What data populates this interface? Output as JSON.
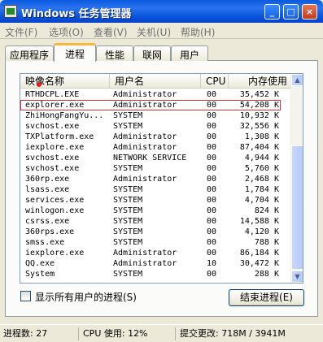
{
  "window": {
    "title": "Windows 任务管理器"
  },
  "titlebar_buttons": {
    "minimize": "_",
    "maximize": "□",
    "close": "×"
  },
  "menu": [
    {
      "label": "文件(F)"
    },
    {
      "label": "选项(O)"
    },
    {
      "label": "查看(V)"
    },
    {
      "label": "关机(U)"
    },
    {
      "label": "帮助(H)"
    }
  ],
  "tabs": [
    {
      "label": "应用程序"
    },
    {
      "label": "进程"
    },
    {
      "label": "性能"
    },
    {
      "label": "联网"
    },
    {
      "label": "用户"
    }
  ],
  "active_tab": "进程",
  "columns": {
    "name": "映像名称",
    "user": "用户名",
    "cpu": "CPU",
    "mem": "内存使用"
  },
  "processes": [
    {
      "name": "RTHDCPL.EXE",
      "user": "Administrator",
      "cpu": "00",
      "mem": "35,452 K"
    },
    {
      "name": "explorer.exe",
      "user": "Administrator",
      "cpu": "00",
      "mem": "54,208 K"
    },
    {
      "name": "ZhiHongFangYu...",
      "user": "SYSTEM",
      "cpu": "00",
      "mem": "10,932 K"
    },
    {
      "name": "svchost.exe",
      "user": "SYSTEM",
      "cpu": "00",
      "mem": "32,556 K"
    },
    {
      "name": "TXPlatform.exe",
      "user": "Administrator",
      "cpu": "00",
      "mem": "1,308 K"
    },
    {
      "name": "iexplore.exe",
      "user": "Administrator",
      "cpu": "00",
      "mem": "87,404 K"
    },
    {
      "name": "svchost.exe",
      "user": "NETWORK SERVICE",
      "cpu": "00",
      "mem": "4,944 K"
    },
    {
      "name": "svchost.exe",
      "user": "SYSTEM",
      "cpu": "00",
      "mem": "5,760 K"
    },
    {
      "name": "360rp.exe",
      "user": "Administrator",
      "cpu": "00",
      "mem": "2,468 K"
    },
    {
      "name": "lsass.exe",
      "user": "SYSTEM",
      "cpu": "00",
      "mem": "1,784 K"
    },
    {
      "name": "services.exe",
      "user": "SYSTEM",
      "cpu": "00",
      "mem": "4,704 K"
    },
    {
      "name": "winlogon.exe",
      "user": "SYSTEM",
      "cpu": "00",
      "mem": "824 K"
    },
    {
      "name": "csrss.exe",
      "user": "SYSTEM",
      "cpu": "00",
      "mem": "14,588 K"
    },
    {
      "name": "360rps.exe",
      "user": "SYSTEM",
      "cpu": "00",
      "mem": "4,120 K"
    },
    {
      "name": "smss.exe",
      "user": "SYSTEM",
      "cpu": "00",
      "mem": "788 K"
    },
    {
      "name": "iexplore.exe",
      "user": "Administrator",
      "cpu": "00",
      "mem": "86,184 K"
    },
    {
      "name": "QQ.exe",
      "user": "Administrator",
      "cpu": "10",
      "mem": "30,472 K"
    },
    {
      "name": "System",
      "user": "SYSTEM",
      "cpu": "00",
      "mem": "288 K"
    }
  ],
  "highlighted_process": "explorer.exe",
  "show_all_users": {
    "label": "显示所有用户的进程(S)",
    "checked": false
  },
  "end_process_button": "结束进程(E)",
  "status": {
    "process_count": "进程数: 27",
    "cpu_usage": "CPU 使用: 12%",
    "commit_charge": "提交更改: 718M / 3941M"
  },
  "colors": {
    "titlebar": "#0a55dc",
    "highlight_box": "#d83030",
    "tab_accent": "#f8b83a"
  }
}
